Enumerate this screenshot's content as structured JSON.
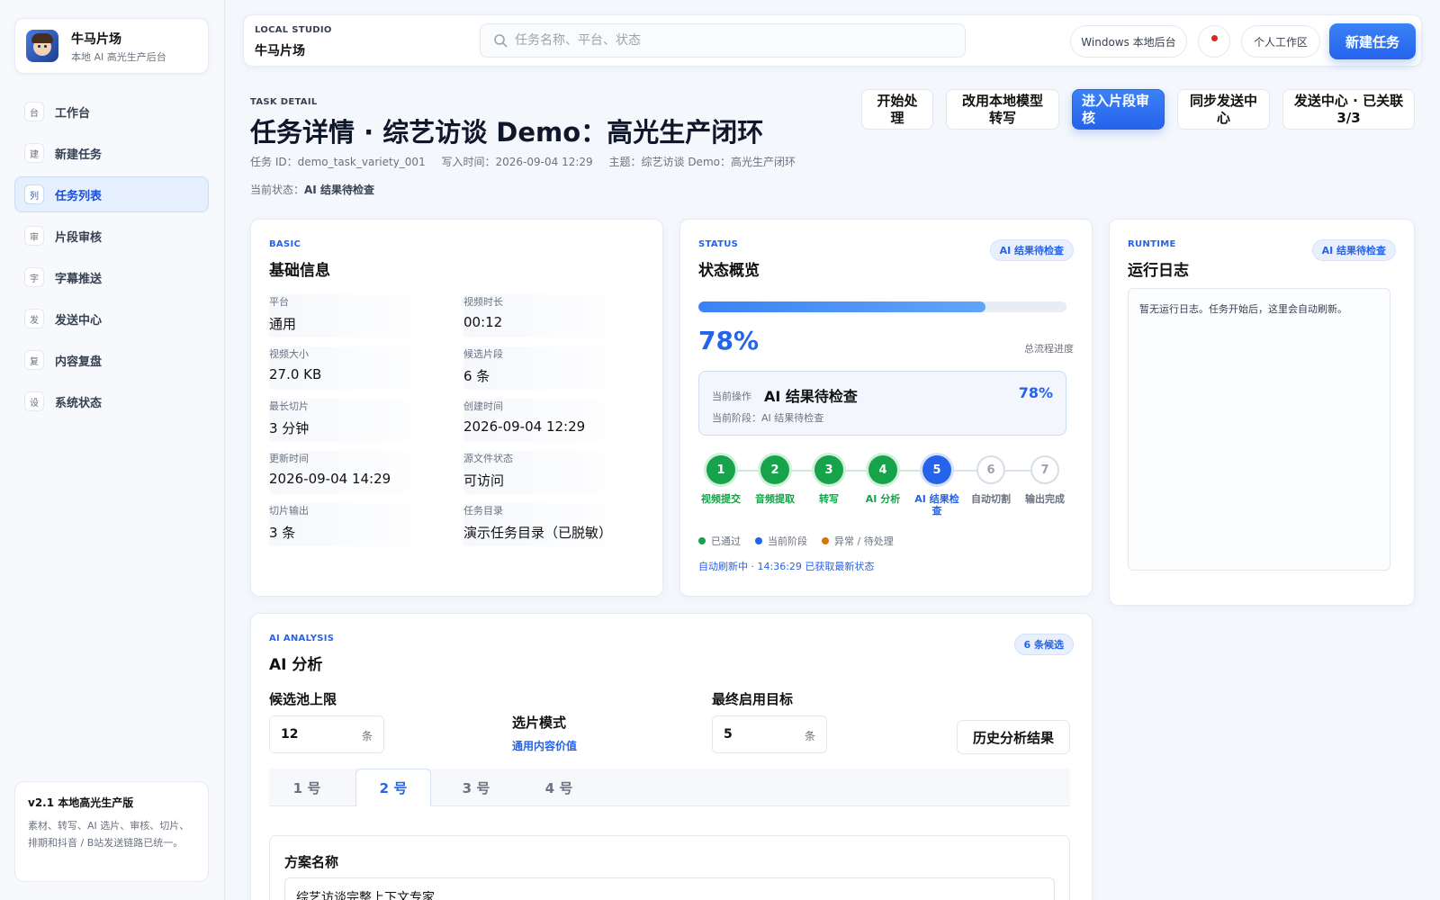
{
  "brand": {
    "name": "牛马片场",
    "subtitle": "本地 AI 高光生产后台"
  },
  "nav": [
    {
      "badge": "台",
      "label": "工作台"
    },
    {
      "badge": "建",
      "label": "新建任务"
    },
    {
      "badge": "列",
      "label": "任务列表",
      "active": true
    },
    {
      "badge": "审",
      "label": "片段审核"
    },
    {
      "badge": "字",
      "label": "字幕推送"
    },
    {
      "badge": "发",
      "label": "发送中心"
    },
    {
      "badge": "复",
      "label": "内容复盘"
    },
    {
      "badge": "设",
      "label": "系统状态"
    }
  ],
  "version": {
    "title": "v2.1 本地高光生产版",
    "desc": "素材、转写、AI 选片、审核、切片、排期和抖音 / B站发送链路已统一。"
  },
  "topbar": {
    "studio_label": "LOCAL STUDIO",
    "studio_name": "牛马片场",
    "search_placeholder": "任务名称、平台、状态",
    "windows_label": "Windows 本地后台",
    "workspace_label": "个人工作区",
    "new_task_label": "新建任务"
  },
  "header": {
    "eyebrow": "TASK DETAIL",
    "title": "任务详情 · 综艺访谈 Demo：高光生产闭环",
    "task_id": "任务 ID：demo_task_variety_001",
    "written_at": "写入时间：2026-09-04 12:29",
    "topic": "主题：综艺访谈 Demo：高光生产闭环",
    "state_prefix": "当前状态：",
    "state_value": "AI 结果待检查"
  },
  "actions": {
    "start": "开始处理",
    "local_model": "改用本地模型转写",
    "enter_review": "进入片段审核",
    "sync_send": "同步发送中心",
    "send_center": "发送中心 · 已关联 3/3"
  },
  "basic": {
    "eyebrow": "BASIC",
    "title": "基础信息",
    "fields": [
      {
        "key": "平台",
        "value": "通用"
      },
      {
        "key": "视频时长",
        "value": "00:12"
      },
      {
        "key": "视频大小",
        "value": "27.0 KB"
      },
      {
        "key": "候选片段",
        "value": "6 条"
      },
      {
        "key": "最长切片",
        "value": "3 分钟"
      },
      {
        "key": "创建时间",
        "value": "2026-09-04 12:29"
      },
      {
        "key": "更新时间",
        "value": "2026-09-04 14:29"
      },
      {
        "key": "源文件状态",
        "value": "可访问"
      },
      {
        "key": "切片输出",
        "value": "3 条"
      },
      {
        "key": "任务目录",
        "value": "演示任务目录（已脱敏）"
      }
    ]
  },
  "status": {
    "eyebrow": "STATUS",
    "title": "状态概览",
    "tag": "AI 结果待检查",
    "progress": 0.78,
    "percent_text": "78%",
    "progress_caption": "总流程进度",
    "op_label": "当前操作",
    "op_value": "AI 结果待检查",
    "op_percent": "78%",
    "op_stage": "当前阶段：AI 结果待检查",
    "steps": [
      {
        "num": "1",
        "name": "视频提交",
        "state": "done"
      },
      {
        "num": "2",
        "name": "音频提取",
        "state": "done"
      },
      {
        "num": "3",
        "name": "转写",
        "state": "done"
      },
      {
        "num": "4",
        "name": "AI 分析",
        "state": "done"
      },
      {
        "num": "5",
        "name": "AI 结果检查",
        "state": "current"
      },
      {
        "num": "6",
        "name": "自动切割",
        "state": "pending"
      },
      {
        "num": "7",
        "name": "输出完成",
        "state": "pending"
      }
    ],
    "legend": [
      {
        "label": "已通过",
        "color": "#16a34a"
      },
      {
        "label": "当前阶段",
        "color": "#2563eb"
      },
      {
        "label": "异常 / 待处理",
        "color": "#d97706"
      }
    ],
    "refresh_text": "自动刷新中 · 14:36:29 已获取最新状态"
  },
  "runtime": {
    "eyebrow": "RUNTIME",
    "title": "运行日志",
    "tag": "AI 结果待检查",
    "log_text": "暂无运行日志。任务开始后，这里会自动刷新。"
  },
  "ai": {
    "eyebrow": "AI ANALYSIS",
    "title": "AI 分析",
    "tag": "6 条候选",
    "pool_label": "候选池上限",
    "pool_value": "12",
    "pool_unit": "条",
    "mode_label": "选片模式",
    "mode_value": "通用内容价值",
    "target_label": "最终启用目标",
    "target_value": "5",
    "target_unit": "条",
    "history_label": "历史分析结果",
    "tabs": [
      "1 号",
      "2 号",
      "3 号",
      "4 号"
    ],
    "active_tab": 1,
    "plan_label": "方案名称",
    "plan_value": "综艺访谈完整上下文专家"
  },
  "colors": {
    "accent": "#2563eb",
    "success": "#16a34a",
    "warning": "#d97706",
    "alert": "#dc2626"
  }
}
